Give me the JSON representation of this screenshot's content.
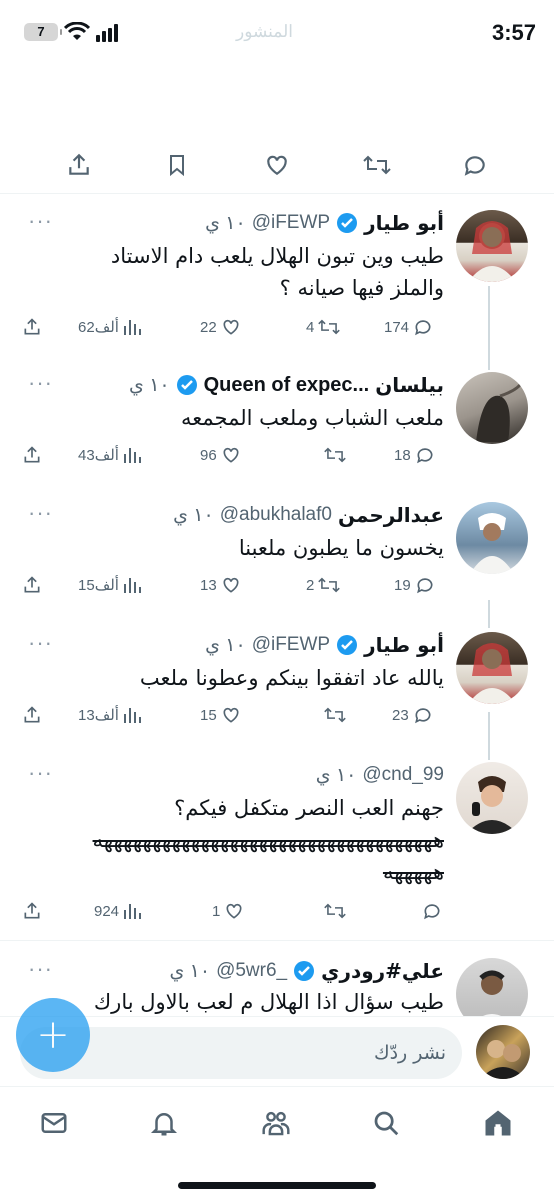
{
  "status_bar": {
    "time": "3:57",
    "battery_level": "7",
    "faded_title": "المنشور"
  },
  "replies": [
    {
      "name": "أبو طيار",
      "verified": true,
      "handle": "@iFEWP",
      "age": "١٠ ي",
      "lines": [
        "طيب وين تبون الهلال يلعب دام الاستاد",
        "والملز فيها صيانه ؟"
      ],
      "replies_count": "174",
      "retweets_count": "4",
      "likes_count": "22",
      "views_count": "62ألف"
    },
    {
      "name": "بيلسان",
      "display_suffix": "Queen of expec...",
      "verified": true,
      "handle": "",
      "age": "١٠ ي",
      "lines": [
        "ملعب الشباب وملعب المجمعه"
      ],
      "replies_count": "18",
      "retweets_count": "",
      "likes_count": "96",
      "views_count": "43ألف"
    },
    {
      "name": "عبدالرحمن",
      "verified": false,
      "handle": "@abukhalaf0",
      "age": "١٠ ي",
      "lines": [
        "يخسون ما يطبون ملعبنا"
      ],
      "replies_count": "19",
      "retweets_count": "2",
      "likes_count": "13",
      "views_count": "15ألف"
    },
    {
      "name": "أبو طيار",
      "verified": true,
      "handle": "@iFEWP",
      "age": "١٠ ي",
      "lines": [
        "يالله عاد اتفقوا بينكم وعطونا ملعب"
      ],
      "replies_count": "23",
      "retweets_count": "",
      "likes_count": "15",
      "views_count": "13ألف"
    },
    {
      "name": "",
      "verified": false,
      "handle": "@cnd_99",
      "age": "١٠ ي",
      "lines": [
        "جهنم العب النصر متكفل فيكم؟",
        "هههههههههههههههههههههههههههههههههههه",
        "هههههه"
      ],
      "replies_count": "",
      "retweets_count": "",
      "likes_count": "1",
      "views_count": "924"
    },
    {
      "name": "علي#رودري",
      "verified": true,
      "handle": "@5wr6_",
      "age": "١٠ ي",
      "lines": [
        "طيب سؤال اذا الهلال م لعب بالاول بارك"
      ],
      "replies_count": "",
      "retweets_count": "",
      "likes_count": "",
      "views_count": ""
    }
  ],
  "composer": {
    "placeholder": "نشر ردّك",
    "fab_label": "+"
  },
  "icons": {
    "share": "share-icon",
    "bookmark": "bookmark-icon",
    "like": "heart-icon",
    "retweet": "retweet-icon",
    "reply": "reply-icon",
    "views": "views-icon",
    "verified": "verified-badge-icon",
    "more": "more-icon"
  },
  "tab_bar": [
    "messages",
    "notifications",
    "communities",
    "search",
    "home"
  ],
  "colors": {
    "accent": "#1d9bf0",
    "text": "#0f1419",
    "muted": "#536471",
    "divider": "#eff3f4"
  }
}
